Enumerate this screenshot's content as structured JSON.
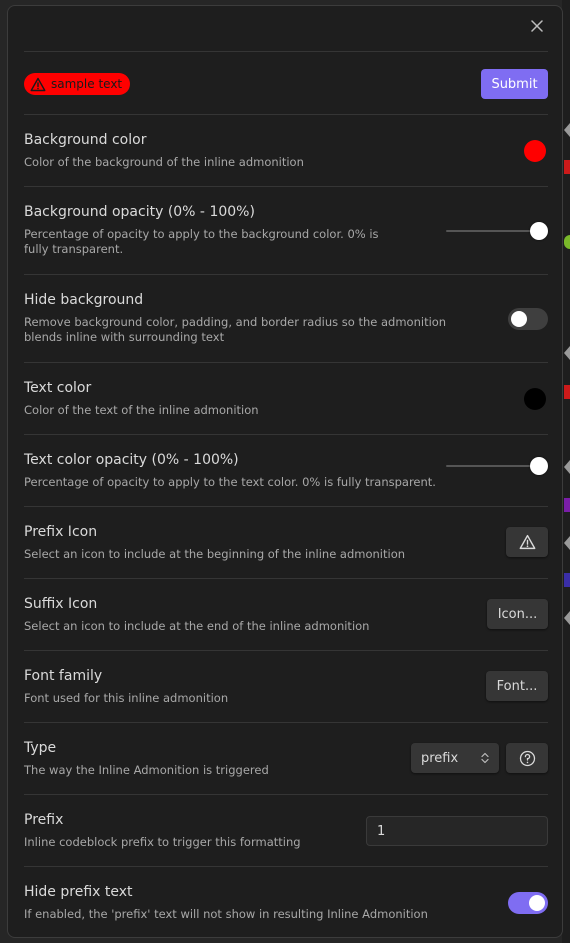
{
  "modal": {
    "close_icon": "close-icon"
  },
  "preview": {
    "icon": "warning-triangle-icon",
    "text": "sample text",
    "background_color": "#ff0000"
  },
  "submit_label": "Submit",
  "settings": [
    {
      "name": "Background color",
      "desc": "Color of the background of the inline admonition",
      "value": "#ff0000"
    },
    {
      "name": "Background opacity (0% - 100%)",
      "desc": "Percentage of opacity to apply to the background color. 0% is fully transparent.",
      "value": 1.0
    },
    {
      "name": "Hide background",
      "desc": "Remove background color, padding, and border radius so the admonition blends inline with surrounding text",
      "value": false
    },
    {
      "name": "Text color",
      "desc": "Color of the text of the inline admonition",
      "value": "#000000"
    },
    {
      "name": "Text color opacity (0% - 100%)",
      "desc": "Percentage of opacity to apply to the text color. 0% is fully transparent.",
      "value": 1.0
    },
    {
      "name": "Prefix Icon",
      "desc": "Select an icon to include at the beginning of the inline admonition",
      "value": "warning-triangle-icon"
    },
    {
      "name": "Suffix Icon",
      "desc": "Select an icon to include at the end of the inline admonition",
      "button_label": "Icon..."
    },
    {
      "name": "Font family",
      "desc": "Font used for this inline admonition",
      "button_label": "Font..."
    },
    {
      "name": "Type",
      "desc": "The way the Inline Admonition is triggered",
      "selected": "prefix",
      "help_icon": "help-circle-icon"
    },
    {
      "name": "Prefix",
      "desc": "Inline codeblock prefix to trigger this formatting",
      "value": "1"
    },
    {
      "name": "Hide prefix text",
      "desc": "If enabled, the 'prefix' text will not show in resulting Inline Admonition",
      "value": true
    }
  ],
  "colors": {
    "accent": "#7f6df2",
    "toggle_off": "#3f3f3f"
  }
}
